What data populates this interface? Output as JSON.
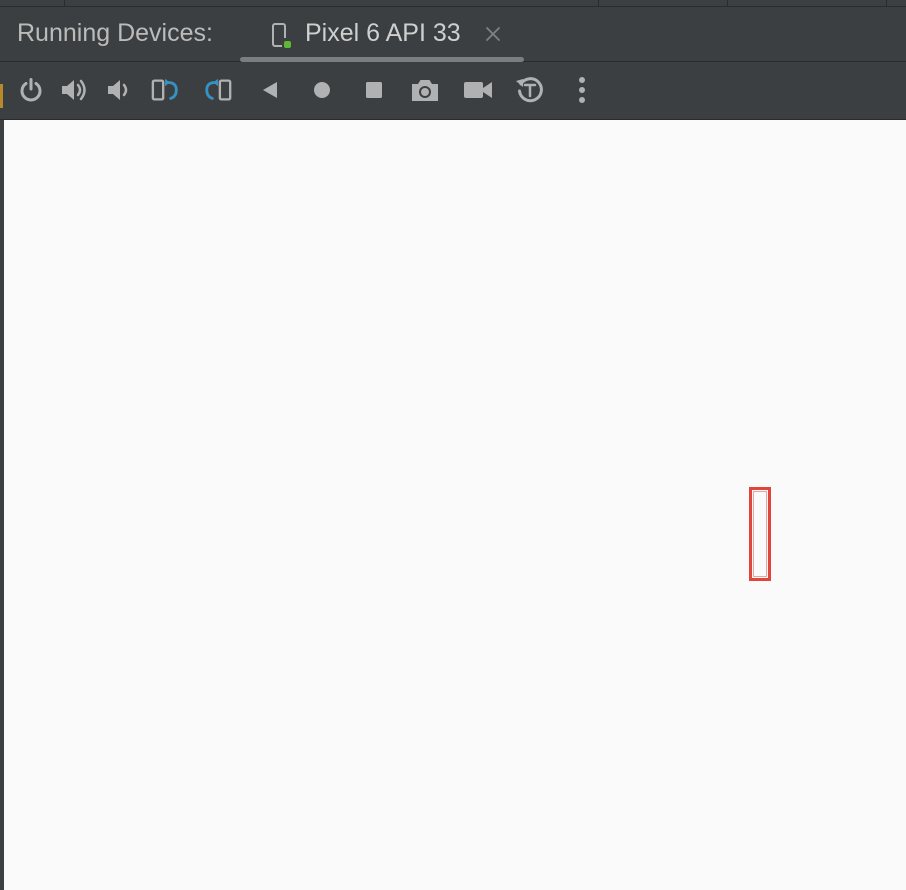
{
  "panel": {
    "title": "Running Devices:"
  },
  "device_tab": {
    "label": "Pixel 6 API 33",
    "icon": "phone-running-icon",
    "close_icon": "close-icon"
  },
  "toolbar": {
    "buttons": [
      {
        "name": "power-button",
        "icon": "power-icon"
      },
      {
        "name": "volume-up-button",
        "icon": "volume-up-icon"
      },
      {
        "name": "volume-down-button",
        "icon": "volume-down-icon"
      },
      {
        "name": "rotate-left-button",
        "icon": "rotate-left-icon"
      },
      {
        "name": "rotate-right-button",
        "icon": "rotate-right-icon"
      },
      {
        "name": "back-button",
        "icon": "back-triangle-icon"
      },
      {
        "name": "home-button",
        "icon": "home-circle-icon"
      },
      {
        "name": "overview-button",
        "icon": "overview-square-icon"
      },
      {
        "name": "screenshot-button",
        "icon": "camera-icon"
      },
      {
        "name": "screen-record-button",
        "icon": "video-camera-icon"
      },
      {
        "name": "snapshot-button",
        "icon": "snapshot-history-icon"
      },
      {
        "name": "more-options-button",
        "icon": "more-vertical-icon"
      }
    ]
  },
  "colors": {
    "chrome_bg": "#3c3f41",
    "screen_bg": "#fafafa",
    "icon_gray": "#afb1b3",
    "icon_blue": "#3592c4",
    "selection_red": "#e0463c",
    "status_green": "#5fb832"
  }
}
